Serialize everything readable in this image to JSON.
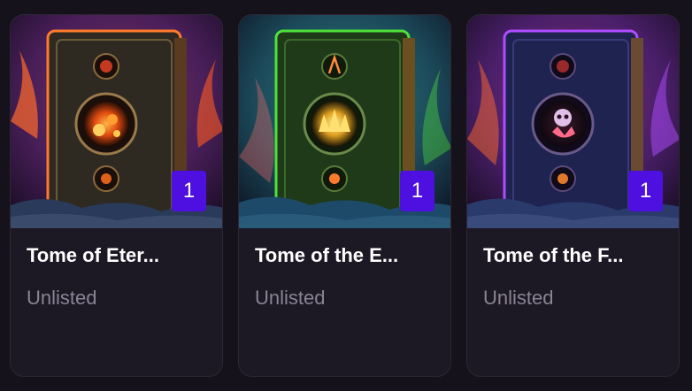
{
  "cards": [
    {
      "title": "Tome of Eter...",
      "status": "Unlisted",
      "quantity": "1",
      "palette": {
        "glow": "#ff5a1f",
        "book": "#2e2a22",
        "sky": "#5b2a6e",
        "emblem": "fire-orbs-icon"
      }
    },
    {
      "title": "Tome of the E...",
      "status": "Unlisted",
      "quantity": "1",
      "palette": {
        "glow": "#4fe03a",
        "book": "#1f3a18",
        "sky": "#1c6a6a",
        "emblem": "earth-crown-icon"
      }
    },
    {
      "title": "Tome of the F...",
      "status": "Unlisted",
      "quantity": "1",
      "palette": {
        "glow": "#b04cff",
        "book": "#1e2350",
        "sky": "#5a2a78",
        "emblem": "skull-hand-icon"
      }
    }
  ],
  "colors": {
    "background": "#16121c",
    "card": "#1c1824",
    "badge": "#4d10e0",
    "status_text": "#8a8494"
  }
}
